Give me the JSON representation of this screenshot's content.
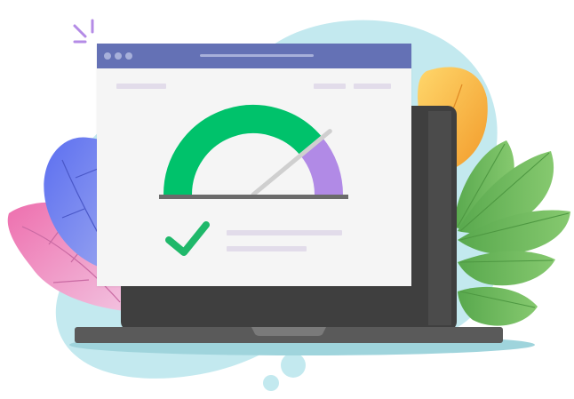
{
  "illustration": {
    "subject": "",
    "gauge": {
      "level": 0.78,
      "colors": {
        "progress": "#00c26b",
        "remaining": "#b18ae6",
        "needle": "#cfcfcf",
        "baseline": "#6b6b6b"
      }
    },
    "status": {
      "icon": "checkmark-icon",
      "color": "#1fb86a"
    },
    "palette": {
      "title_bar": "#6471b5",
      "window_bg": "#f5f5f5",
      "laptop_body": "#3f3f3f",
      "laptop_base": "#5a5a5a",
      "blob": "#c3e9ef",
      "leaf_green": "#6bb85a",
      "leaf_blue": "#6a7ee8",
      "leaf_pink": "#e87cb7",
      "leaf_orange": "#f3a93a",
      "sparkle": "#b48be6"
    }
  }
}
